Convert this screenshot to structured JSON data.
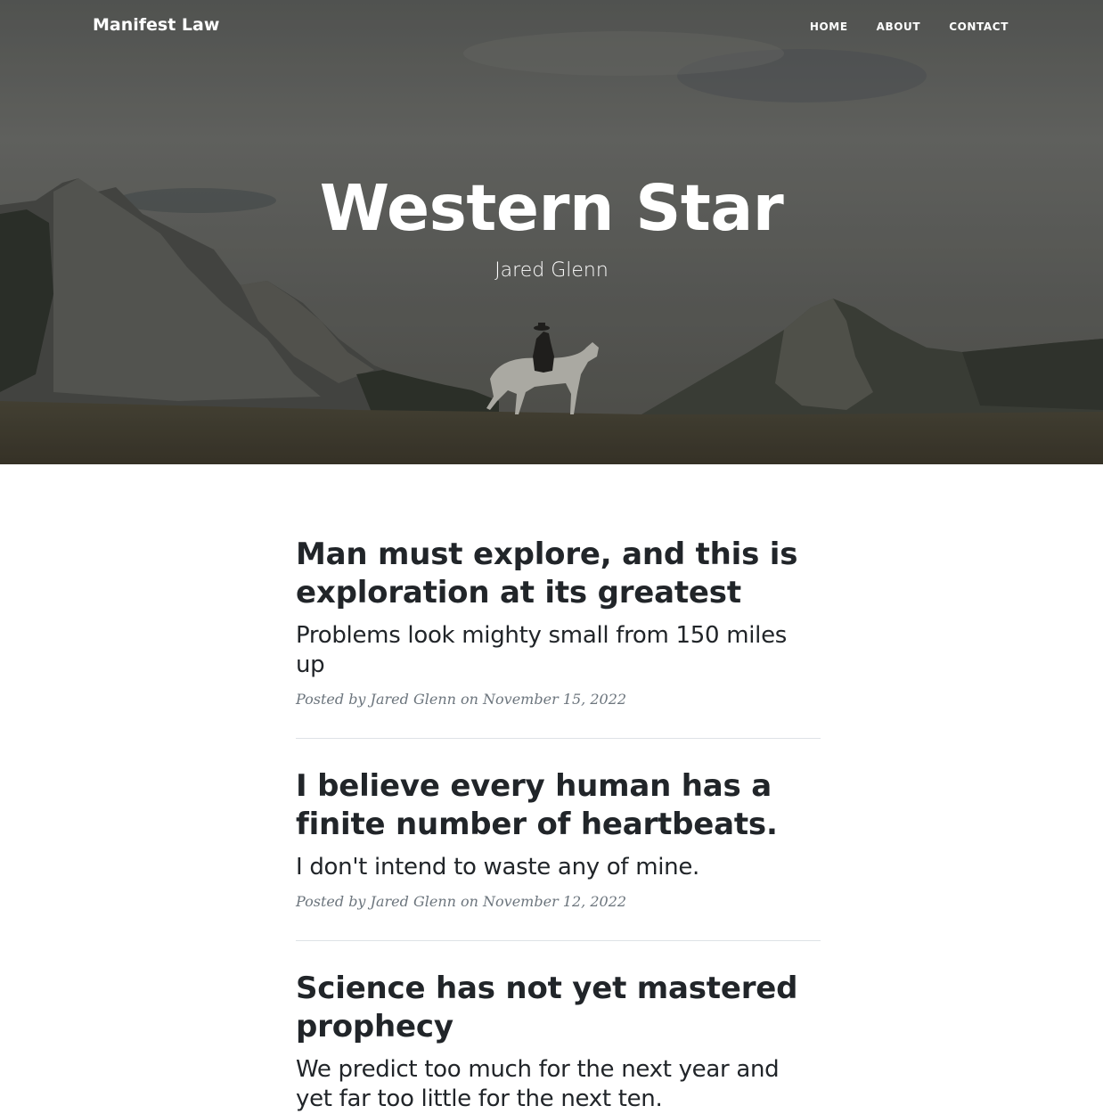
{
  "navbar": {
    "brand": "Manifest Law",
    "links": [
      {
        "label": "HOME"
      },
      {
        "label": "ABOUT"
      },
      {
        "label": "CONTACT"
      }
    ]
  },
  "hero": {
    "title": "Western Star",
    "subtitle": "Jared Glenn"
  },
  "posts": [
    {
      "title": "Man must explore, and this is exploration at its greatest",
      "subtitle": "Problems look mighty small from 150 miles up",
      "meta": "Posted by Jared Glenn on November 15, 2022"
    },
    {
      "title": "I believe every human has a finite number of heartbeats.",
      "subtitle": "I don't intend to waste any of mine.",
      "meta": "Posted by Jared Glenn on November 12, 2022"
    },
    {
      "title": "Science has not yet mastered prophecy",
      "subtitle": "We predict too much for the next year and yet far too little for the next ten."
    }
  ],
  "colors": {
    "text": "#212529",
    "meta": "#6c757d",
    "divider": "#dee2e6"
  },
  "icons": {
    "hero_image": "mountain-rider-landscape"
  }
}
